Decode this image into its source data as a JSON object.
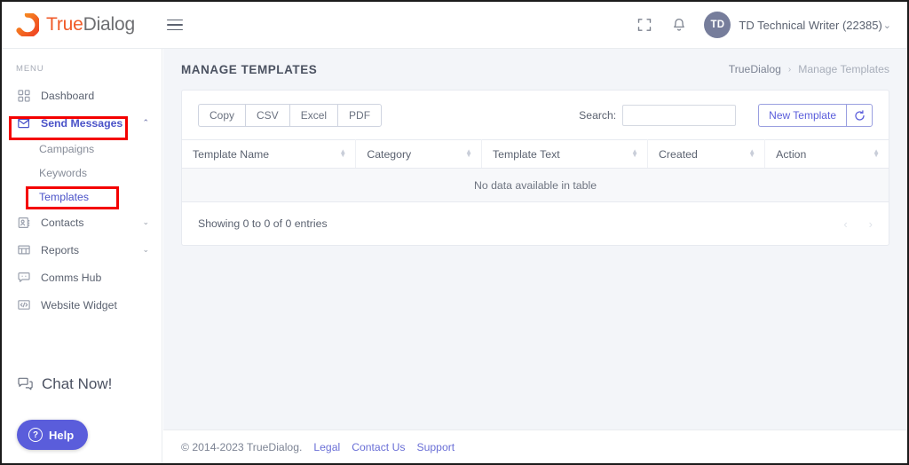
{
  "header": {
    "logo_primary": "True",
    "logo_secondary": "Dialog",
    "logo_icon": "truedialog-ring-logo",
    "menu_toggle_icon": "hamburger-icon",
    "fullscreen_icon": "fullscreen-icon",
    "notifications_icon": "bell-icon",
    "avatar_initials": "TD",
    "user_name": "TD Technical Writer (22385)",
    "user_caret_icon": "chevron-down-icon"
  },
  "sidebar": {
    "section_label": "MENU",
    "items": [
      {
        "label": "Dashboard",
        "icon": "dashboard-grid-icon",
        "active": false,
        "expandable": false
      },
      {
        "label": "Send Messages",
        "icon": "send-message-envelope-icon",
        "active": true,
        "expandable": true,
        "chevron": "chevron-up-icon"
      },
      {
        "label": "Contacts",
        "icon": "contacts-card-icon",
        "active": false,
        "expandable": true,
        "chevron": "chevron-down-icon"
      },
      {
        "label": "Reports",
        "icon": "reports-table-icon",
        "active": false,
        "expandable": true,
        "chevron": "chevron-down-icon"
      },
      {
        "label": "Comms Hub",
        "icon": "comms-hub-chat-icon",
        "active": false,
        "expandable": false
      },
      {
        "label": "Website Widget",
        "icon": "website-widget-code-icon",
        "active": false,
        "expandable": false
      }
    ],
    "sub_items": [
      {
        "label": "Campaigns",
        "current": false
      },
      {
        "label": "Keywords",
        "current": false
      },
      {
        "label": "Templates",
        "current": true
      }
    ],
    "chat_now": {
      "label": "Chat Now!",
      "icon": "chat-bubbles-icon"
    },
    "help_button": {
      "label": "Help",
      "icon": "question-circle-icon"
    }
  },
  "main": {
    "page_title": "MANAGE TEMPLATES",
    "breadcrumb": {
      "root": "TrueDialog",
      "separator": "›",
      "current": "Manage Templates"
    },
    "export_buttons": [
      "Copy",
      "CSV",
      "Excel",
      "PDF"
    ],
    "search": {
      "label": "Search:",
      "value": "",
      "placeholder": ""
    },
    "new_template_button": "New Template",
    "refresh_icon": "refresh-circle-icon",
    "table": {
      "columns": [
        "Template Name",
        "Category",
        "Template Text",
        "Created",
        "Action"
      ],
      "sort_icon": "sort-updown-icon",
      "rows": [],
      "empty_message": "No data available in table"
    },
    "entries_text": "Showing 0 to 0 of 0 entries",
    "pagination": {
      "prev_icon": "chevron-left-icon",
      "next_icon": "chevron-right-icon"
    }
  },
  "footer": {
    "copyright": "© 2014-2023 TrueDialog.",
    "links": [
      "Legal",
      "Contact Us",
      "Support"
    ]
  },
  "annotations": {
    "highlight_color": "#f40000",
    "boxes": [
      "send-messages-nav-highlight",
      "templates-subnav-highlight"
    ]
  },
  "colors": {
    "brand_orange": "#f05a28",
    "accent_purple": "#5a5ddb",
    "main_bg": "#f3f5f9",
    "text_muted": "#7d8494"
  }
}
